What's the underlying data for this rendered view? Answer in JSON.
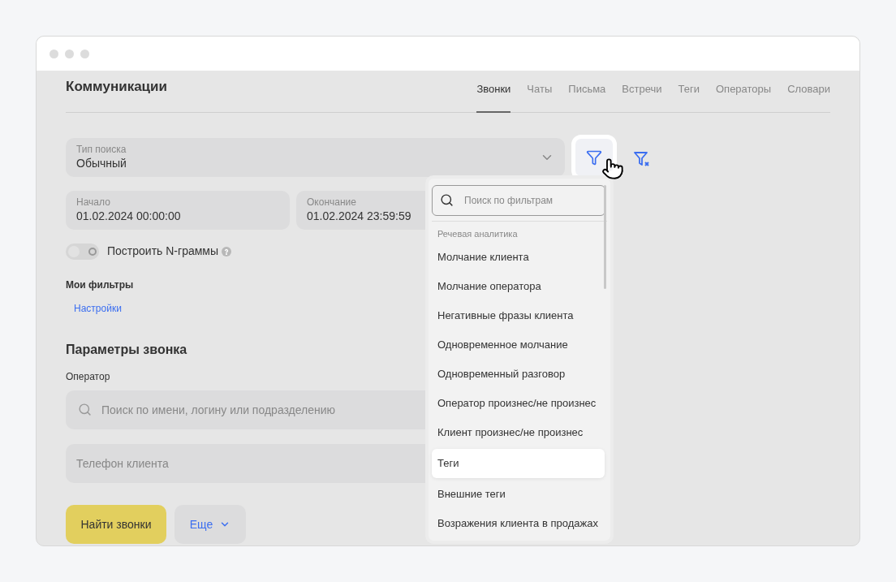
{
  "page": {
    "title": "Коммуникации"
  },
  "tabs": [
    {
      "label": "Звонки",
      "selected": true
    },
    {
      "label": "Чаты",
      "selected": false
    },
    {
      "label": "Письма",
      "selected": false
    },
    {
      "label": "Встречи",
      "selected": false
    },
    {
      "label": "Теги",
      "selected": false
    },
    {
      "label": "Операторы",
      "selected": false
    },
    {
      "label": "Словари",
      "selected": false
    }
  ],
  "search_type": {
    "label": "Тип поиска",
    "value": "Обычный"
  },
  "period": [
    {
      "label": "Начало",
      "value": "01.02.2024 00:00:00"
    },
    {
      "label": "Окончание",
      "value": "01.02.2024 23:59:59"
    }
  ],
  "ngrams": {
    "label": "Построить N-граммы",
    "on": false
  },
  "my_filters": {
    "title": "Мои фильтры",
    "link": "Настройки"
  },
  "call_params": {
    "title": "Параметры звонка",
    "operator_label": "Оператор",
    "operator_placeholder": "Поиск по имени, логину или подразделению",
    "phone_placeholder": "Телефон клиента"
  },
  "buttons": {
    "primary": "Найти звонки",
    "more": "Еще"
  },
  "filter_menu": {
    "search_placeholder": "Поиск по фильтрам",
    "section": "Речевая аналитика",
    "items": [
      {
        "label": "Молчание клиента",
        "selected": false
      },
      {
        "label": "Молчание оператора",
        "selected": false
      },
      {
        "label": "Негативные фразы клиента",
        "selected": false
      },
      {
        "label": "Одновременное молчание",
        "selected": false
      },
      {
        "label": "Одновременный разговор",
        "selected": false
      },
      {
        "label": "Оператор произнес/не произнес",
        "selected": false
      },
      {
        "label": "Клиент произнес/не произнес",
        "selected": false
      },
      {
        "label": "Теги",
        "selected": true
      },
      {
        "label": "Внешние теги",
        "selected": false
      },
      {
        "label": "Возражения клиента в продажах",
        "selected": false
      }
    ]
  }
}
